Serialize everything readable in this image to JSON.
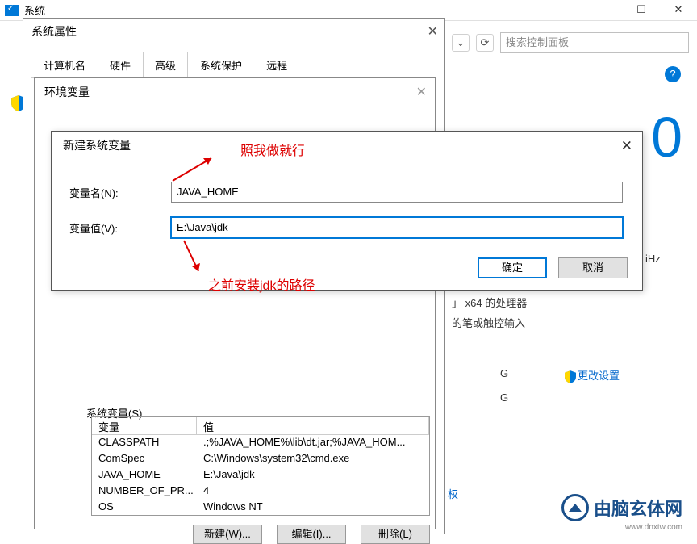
{
  "top": {
    "title": "系统",
    "min": "—",
    "max": "☐",
    "close": "✕"
  },
  "toolbar": {
    "back": "←",
    "fwd": "→",
    "drop": "⌄",
    "refresh": "⟳",
    "search": "搜索控制面板"
  },
  "help": "?",
  "big": "0",
  "bg": {
    "ghz": "iHz",
    "proc": "x64 的处理器",
    "pen": "的笔或触控输入",
    "g1": "G",
    "g2": "G",
    "change": "更改设置",
    "blue": "权"
  },
  "prop": {
    "title": "系统属性",
    "tabs": [
      "计算机名",
      "硬件",
      "高级",
      "系统保护",
      "远程"
    ]
  },
  "env": {
    "title": "环境变量",
    "user_label": "",
    "sys_label": "系统变量(S)"
  },
  "sysvar": {
    "header": {
      "c1": "变量",
      "c2": "值"
    },
    "rows": [
      {
        "c1": "CLASSPATH",
        "c2": ".;%JAVA_HOME%\\lib\\dt.jar;%JAVA_HOM..."
      },
      {
        "c1": "ComSpec",
        "c2": "C:\\Windows\\system32\\cmd.exe"
      },
      {
        "c1": "JAVA_HOME",
        "c2": "E:\\Java\\jdk"
      },
      {
        "c1": "NUMBER_OF_PR...",
        "c2": "4"
      },
      {
        "c1": "OS",
        "c2": "Windows NT"
      }
    ]
  },
  "buttons": {
    "new": "新建(W)...",
    "edit": "编辑(I)...",
    "del": "删除(L)"
  },
  "newvar": {
    "title": "新建系统变量",
    "name_label": "变量名(N):",
    "name_value": "JAVA_HOME",
    "val_label": "变量值(V):",
    "val_value": "E:\\Java\\jdk",
    "ok": "确定",
    "cancel": "取消"
  },
  "anno": {
    "a1": "照我做就行",
    "a2": "之前安装jdk的路径"
  },
  "logo": {
    "text": "由脑玄体网",
    "sub": "www.dnxtw.com"
  }
}
